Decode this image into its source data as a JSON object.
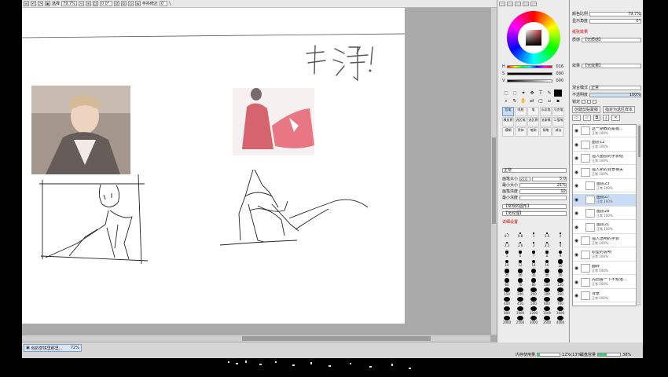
{
  "toolbar": {
    "select_label": "选择",
    "zoom": "79.7%",
    "rotation": "0.0°",
    "stabilizer_label": "手抖修正",
    "stabilizer_value": "0"
  },
  "canvas": {
    "handwritten_text": "干净!",
    "reference_photos": [
      "reference-photo-man",
      "reference-photo-red-costume"
    ]
  },
  "status": {
    "file_name": "他的梦境里那里...",
    "file_zoom": "72%",
    "memory_label": "内存使用量",
    "memory_value": "12%(13%)",
    "memory_fraction": 0.12,
    "disk_label": "磁盘容量",
    "disk_value": "38%",
    "disk_fraction": 0.38
  },
  "color_panel": {
    "sliders": [
      {
        "label": "H",
        "value": "016"
      },
      {
        "label": "S",
        "value": "000"
      },
      {
        "label": "V",
        "value": "000"
      }
    ],
    "tool_names": [
      "铅笔",
      "喷枪",
      "笔",
      "水彩笔",
      "马克笔",
      "橡皮擦",
      "选区笔",
      "选区擦",
      "油漆桶",
      "二值笔",
      "模糊",
      "涂抹",
      "笔刷",
      "钢笔",
      "减淡"
    ],
    "mode_label": "正常",
    "brush_size_label": "画笔大小",
    "brush_size_mult": "x5.0",
    "brush_size_value": "5.0",
    "min_size_label": "最小大小",
    "min_size_value": "21%",
    "density_label": "画笔浓度",
    "density_value": "92",
    "min_density_label": "最小浓度",
    "texture_label": "【常规的圆形】",
    "texture2_label": "【无纹理】",
    "advanced_label": "详细设置",
    "sizes": [
      "0.7",
      "0.8",
      "1",
      "1.5",
      "2",
      "2.3",
      "2.6",
      "3",
      "3.5",
      "4",
      "5",
      "6",
      "7",
      "8",
      "9",
      "10",
      "12",
      "14",
      "16",
      "20",
      "25",
      "30",
      "35",
      "40",
      "50",
      "60",
      "70",
      "80",
      "100",
      "120",
      "150",
      "200",
      "250",
      "300",
      "350",
      "400",
      "450",
      "500",
      "600",
      "700",
      "800",
      "1000",
      "1200",
      "1500",
      "1600",
      "2000",
      "2500",
      "3000",
      "3500",
      "4000"
    ]
  },
  "layer_panel": {
    "opacity_label": "颜色比例",
    "opacity_value": "79.7%",
    "rotation_label": "显示角度",
    "rotation_value": "0°",
    "effects_header": "纸张效果",
    "texture_label": "质感",
    "texture_value": "【无质感】",
    "effect_label": "效果",
    "effect_value": "【无效果】",
    "blend_label": "混合模式",
    "blend_value": "正常",
    "layer_opacity_label": "不透明度",
    "layer_opacity_value": "100%",
    "lock_label": "锁定",
    "clip_label": "创建剪贴蒙版",
    "select_source_label": "指定为选区样本",
    "layers": [
      {
        "name": "这一期教的是极...",
        "sub": "正常 100%",
        "selected": false,
        "indent": false
      },
      {
        "name": "图层12",
        "sub": "正常 100%",
        "selected": false,
        "indent": false
      },
      {
        "name": "插入图层的手表结",
        "sub": "正常 100%",
        "selected": false,
        "indent": false
      },
      {
        "name": "插入新的背景相关",
        "sub": "正常 100%",
        "selected": false,
        "indent": false
      },
      {
        "name": "图层23",
        "sub": "正常 100%",
        "selected": false,
        "indent": true
      },
      {
        "name": "图层27",
        "sub": "正常 100%",
        "selected": true,
        "indent": true
      },
      {
        "name": "图层28",
        "sub": "正常 100%",
        "selected": false,
        "indent": true
      },
      {
        "name": "图层21",
        "sub": "正常 100%",
        "selected": false,
        "indent": true
      },
      {
        "name": "插入透明的手表",
        "sub": "正常 100%",
        "selected": false,
        "indent": false
      },
      {
        "name": "原型的说明",
        "sub": "正常 100%",
        "selected": false,
        "indent": false
      },
      {
        "name": "翻转",
        "sub": "正常 100%",
        "selected": false,
        "indent": false
      },
      {
        "name": "先回答一下不知道...",
        "sub": "正常 100%",
        "selected": false,
        "indent": false
      },
      {
        "name": "背景",
        "sub": "正常 100%",
        "selected": false,
        "indent": false
      }
    ]
  }
}
